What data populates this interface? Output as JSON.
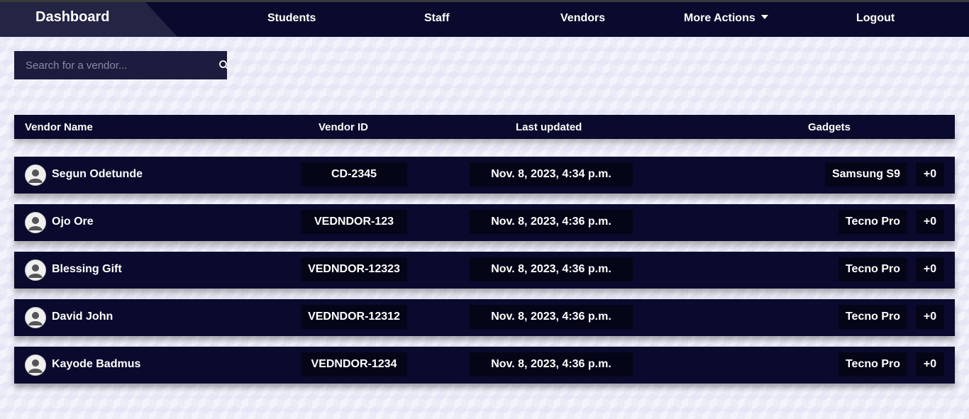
{
  "nav": {
    "brand": "Dashboard",
    "links": [
      "Students",
      "Staff",
      "Vendors",
      "More Actions",
      "Logout"
    ]
  },
  "search": {
    "placeholder": "Search for a vendor..."
  },
  "table": {
    "headers": [
      "Vendor Name",
      "Vendor ID",
      "Last updated",
      "Gadgets"
    ],
    "rows": [
      {
        "name": "Segun Odetunde",
        "id": "CD-2345",
        "updated": "Nov. 8, 2023, 4:34 p.m.",
        "gadget": "Samsung S9",
        "more": "+0"
      },
      {
        "name": "Ojo Ore",
        "id": "VEDNDOR-123",
        "updated": "Nov. 8, 2023, 4:36 p.m.",
        "gadget": "Tecno Pro",
        "more": "+0"
      },
      {
        "name": "Blessing Gift",
        "id": "VEDNDOR-12323",
        "updated": "Nov. 8, 2023, 4:36 p.m.",
        "gadget": "Tecno Pro",
        "more": "+0"
      },
      {
        "name": "David John",
        "id": "VEDNDOR-12312",
        "updated": "Nov. 8, 2023, 4:36 p.m.",
        "gadget": "Tecno Pro",
        "more": "+0"
      },
      {
        "name": "Kayode Badmus",
        "id": "VEDNDOR-1234",
        "updated": "Nov. 8, 2023, 4:36 p.m.",
        "gadget": "Tecno Pro",
        "more": "+0"
      }
    ]
  },
  "colors": {
    "nav_bg": "#0a0a2e",
    "brand_bg": "#242445",
    "row_bg": "#0a0a2e",
    "cell_bg": "#050518"
  }
}
